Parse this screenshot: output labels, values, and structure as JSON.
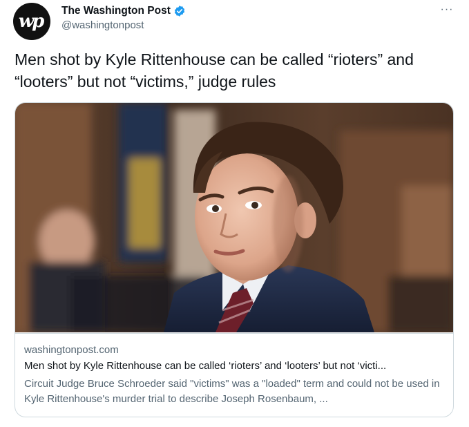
{
  "author": {
    "avatar_text": "wp",
    "name": "The Washington Post",
    "handle": "@washingtonpost",
    "verified": true
  },
  "menu": {
    "more_label": "···"
  },
  "tweet": {
    "text": "Men shot by Kyle Rittenhouse can be called “rioters” and “looters” but not “victims,” judge rules"
  },
  "card": {
    "domain": "washingtonpost.com",
    "title": "Men shot by Kyle Rittenhouse can be called ‘rioters’ and ‘looters’ but not ‘victi...",
    "description": "Circuit Judge Bruce Schroeder said \"victims\" was a \"loaded\" term and could not be used in Kyle Rittenhouse's murder trial to describe Joseph Rosenbaum, ..."
  },
  "colors": {
    "text_primary": "#0f1419",
    "text_secondary": "#536471",
    "verified_blue": "#1d9bf0",
    "border": "#cfd9de",
    "suit_navy": "#1f2a44"
  }
}
